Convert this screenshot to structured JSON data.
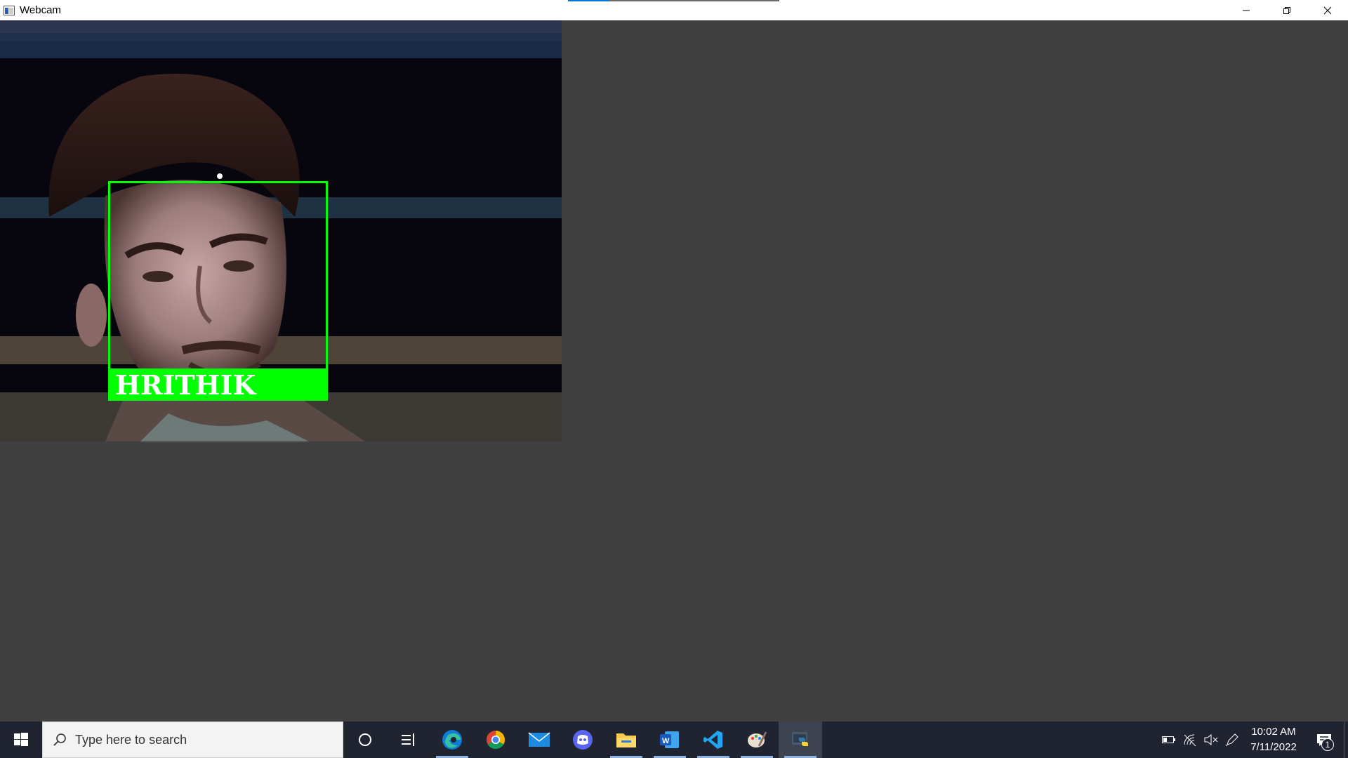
{
  "window": {
    "title": "Webcam",
    "controls": {
      "minimize": "minimize",
      "restore": "restore",
      "close": "close"
    }
  },
  "webcam": {
    "detected_name": "HRITHIK",
    "box_color": "#00ff00"
  },
  "taskbar": {
    "search_placeholder": "Type here to search",
    "apps": [
      {
        "name": "cortana",
        "icon": "circle-icon"
      },
      {
        "name": "task-view",
        "icon": "task-view-icon"
      },
      {
        "name": "edge",
        "icon": "edge-icon"
      },
      {
        "name": "chrome",
        "icon": "chrome-icon"
      },
      {
        "name": "mail",
        "icon": "mail-icon"
      },
      {
        "name": "discord",
        "icon": "discord-icon"
      },
      {
        "name": "file-explorer",
        "icon": "folder-icon"
      },
      {
        "name": "word",
        "icon": "word-icon"
      },
      {
        "name": "vscode",
        "icon": "vscode-icon"
      },
      {
        "name": "paint",
        "icon": "paint-icon"
      },
      {
        "name": "python",
        "icon": "python-icon"
      }
    ],
    "clock": {
      "time": "10:02 AM",
      "date": "7/11/2022"
    },
    "notification_count": "1"
  },
  "colors": {
    "accent": "#0078d7",
    "taskbar_bg": "#1f2430",
    "window_bg": "#404040"
  }
}
